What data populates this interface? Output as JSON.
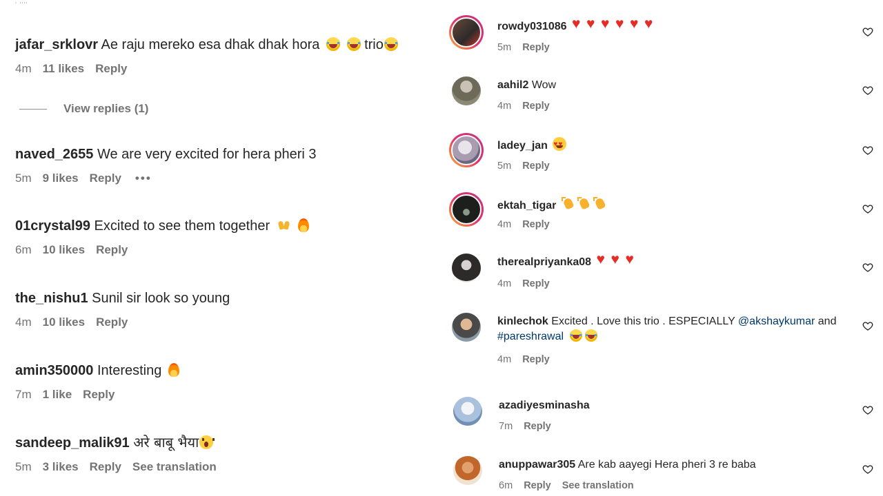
{
  "left": {
    "top_fragment": "' ''''",
    "view_replies": "View replies (1)",
    "comments": [
      {
        "user": "jafar_srklovr",
        "text": "Ae raju mereko esa dhak dhak hora",
        "suffix": "trio",
        "time": "4m",
        "likes": "11 likes",
        "reply": "Reply"
      },
      {
        "user": "naved_2655",
        "text": "We are very excited for hera pheri 3",
        "time": "5m",
        "likes": "9 likes",
        "reply": "Reply",
        "more": "•••"
      },
      {
        "user": "01crystal99",
        "text": "Excited to see them together",
        "time": "6m",
        "likes": "10 likes",
        "reply": "Reply"
      },
      {
        "user": "the_nishu1",
        "text": "Sunil sir look so young",
        "time": "4m",
        "likes": "10 likes",
        "reply": "Reply"
      },
      {
        "user": "amin350000",
        "text": "Interesting",
        "time": "7m",
        "likes": "1 like",
        "reply": "Reply"
      },
      {
        "user": "sandeep_malik91",
        "text": "अरे बाबू भैया",
        "time": "5m",
        "likes": "3 likes",
        "reply": "Reply",
        "translate": "See translation"
      }
    ]
  },
  "right": {
    "comments": [
      {
        "user": "rowdy031086",
        "text": "",
        "time": "5m",
        "reply": "Reply"
      },
      {
        "user": "aahil2",
        "text": "Wow",
        "time": "4m",
        "reply": "Reply"
      },
      {
        "user": "ladey_jan",
        "text": "",
        "time": "5m",
        "reply": "Reply"
      },
      {
        "user": "ektah_tigar",
        "text": "",
        "time": "4m",
        "reply": "Reply"
      },
      {
        "user": "therealpriyanka08",
        "text": "",
        "time": "4m",
        "reply": "Reply"
      },
      {
        "user": "kinlechok",
        "text": "Excited . Love this trio . ESPECIALLY",
        "mention": "@akshaykumar",
        "and": "and",
        "hashtag": "#pareshrawal",
        "time": "4m",
        "reply": "Reply"
      },
      {
        "user": "azadiyesminasha",
        "text": "",
        "time": "7m",
        "reply": "Reply"
      },
      {
        "user": "anuppawar305",
        "text": "Are kab aayegi Hera pheri 3 re baba",
        "time": "6m",
        "reply": "Reply",
        "translate": "See translation"
      }
    ]
  },
  "icons": {
    "like": "heart-outline-icon",
    "more": "more-dots-icon"
  },
  "colors": {
    "text": "#262626",
    "secondary": "#737373",
    "link": "#00376b",
    "story_ring_start": "#f9b233",
    "story_ring_end": "#c13584",
    "heart_emoji": "#e52d27"
  }
}
